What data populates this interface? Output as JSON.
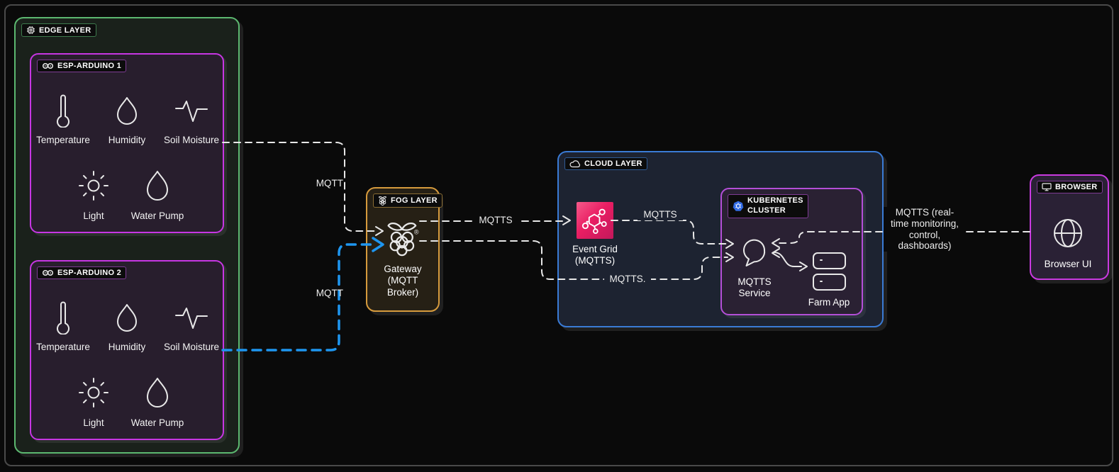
{
  "edge": {
    "title": "EDGE LAYER"
  },
  "esp1": {
    "title": "ESP-ARDUINO 1",
    "sensors": {
      "temperature": "Temperature",
      "humidity": "Humidity",
      "soil": "Soil Moisture",
      "light": "Light",
      "pump": "Water Pump"
    }
  },
  "esp2": {
    "title": "ESP-ARDUINO 2",
    "sensors": {
      "temperature": "Temperature",
      "humidity": "Humidity",
      "soil": "Soil Moisture",
      "light": "Light",
      "pump": "Water Pump"
    }
  },
  "fog": {
    "title": "FOG LAYER",
    "node_label": "Gateway\n(MQTT\nBroker)"
  },
  "cloud": {
    "title": "CLOUD LAYER",
    "event_grid_label": "Event Grid\n(MQTTS)"
  },
  "k8s": {
    "title": "KUBERNETES\nCLUSTER",
    "service_label": "MQTTS\nService",
    "app_label": "Farm App"
  },
  "browser": {
    "title": "BROWSER",
    "node_label": "Browser UI"
  },
  "connections": {
    "esp1_to_gateway": "MQTT",
    "esp2_to_gateway": "MQTT",
    "gateway_to_eventgrid": "MQTTS",
    "eventgrid_to_service": "MQTTS",
    "gateway_to_service": "MQTTS.",
    "service_to_browser": "MQTTS (real-\ntime monitoring,\ncontrol,\ndashboards)"
  },
  "colors": {
    "edge_border": "#5cb870",
    "esp_border": "#c736e3",
    "fog_border": "#d79b3d",
    "cloud_border": "#3a7bd5",
    "k8s_border": "#b44fd8",
    "browser_border": "#c93ae0",
    "event_grid_icon": "#e91e63",
    "kubernetes_icon": "#326ce5",
    "mqtt_line_blue": "#1e96f0",
    "line_white": "#e8e8e8"
  }
}
